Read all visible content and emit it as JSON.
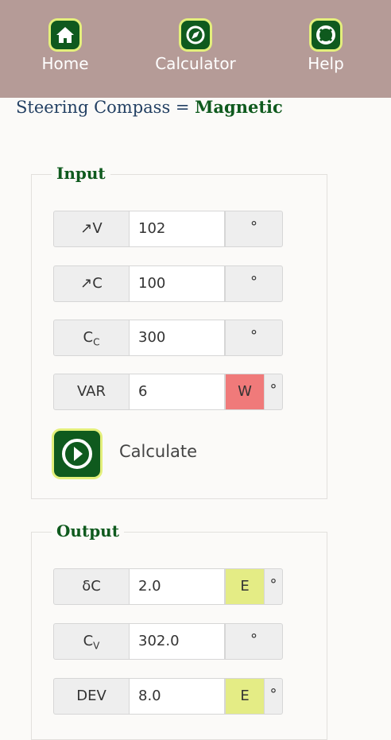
{
  "nav": {
    "home_label": "Home",
    "calc_label": "Calculator",
    "help_label": "Help"
  },
  "header": {
    "prefix": "Steering Compass = ",
    "value": "Magnetic"
  },
  "input": {
    "legend": "Input",
    "rows": [
      {
        "label": "↗V",
        "value": "102",
        "unit": "°"
      },
      {
        "label": "↗C",
        "value": "100",
        "unit": "°"
      },
      {
        "label": "C",
        "label_sub": "C",
        "value": "300",
        "unit": "°"
      },
      {
        "label": "VAR",
        "value": "6",
        "direction": "W",
        "unit": "°"
      }
    ],
    "calculate_label": "Calculate"
  },
  "output": {
    "legend": "Output",
    "rows": [
      {
        "label": "δC",
        "value": "2.0",
        "direction": "E",
        "unit": "°"
      },
      {
        "label": "C",
        "label_sub": "V",
        "value": "302.0",
        "unit": "°"
      },
      {
        "label": "DEV",
        "value": "8.0",
        "direction": "E",
        "unit": "°"
      }
    ]
  },
  "colors": {
    "topbar": "#b59b97",
    "accent": "#0f5a1e",
    "icon_ring": "#e3ef7b",
    "west": "#f07a7a",
    "east": "#e4ec85"
  }
}
